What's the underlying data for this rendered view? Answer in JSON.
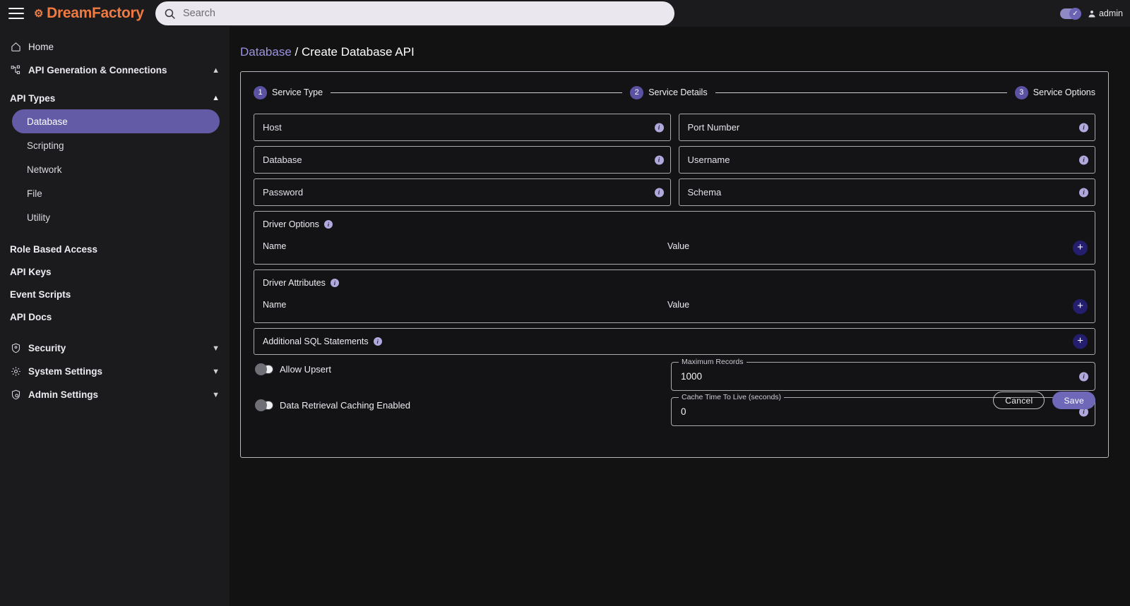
{
  "app": {
    "brand": "DreamFactory",
    "brand_icon": "gear-icon",
    "menu_icon": "hamburger-menu-icon"
  },
  "search": {
    "placeholder": "Search",
    "value": "",
    "icon": "search-icon"
  },
  "topbar": {
    "theme_toggle": {
      "state": "on",
      "icon": "check-icon"
    },
    "user": {
      "name": "admin",
      "icon": "person-icon"
    }
  },
  "sidebar": {
    "items": [
      {
        "label": "Home",
        "icon": "home-icon"
      },
      {
        "label": "API Generation & Connections",
        "icon": "sitemap-icon",
        "chevron": "chevron-up-icon",
        "expanded": true
      }
    ],
    "api_types": {
      "label": "API Types",
      "chevron": "chevron-up-icon",
      "children": [
        {
          "label": "Database",
          "active": true
        },
        {
          "label": "Scripting",
          "active": false
        },
        {
          "label": "Network",
          "active": false
        },
        {
          "label": "File",
          "active": false
        },
        {
          "label": "Utility",
          "active": false
        }
      ]
    },
    "secondary": [
      {
        "label": "Role Based Access"
      },
      {
        "label": "API Keys"
      },
      {
        "label": "Event Scripts"
      },
      {
        "label": "API Docs"
      }
    ],
    "groups": [
      {
        "label": "Security",
        "icon": "shield-icon",
        "chevron": "chevron-down-icon"
      },
      {
        "label": "System Settings",
        "icon": "gear-icon",
        "chevron": "chevron-down-icon"
      },
      {
        "label": "Admin Settings",
        "icon": "shield-lock-icon",
        "chevron": "chevron-down-icon"
      }
    ]
  },
  "breadcrumb": {
    "parent": "Database",
    "separator": "/",
    "current": "Create Database API"
  },
  "stepper": {
    "steps": [
      {
        "num": "1",
        "label": "Service Type"
      },
      {
        "num": "2",
        "label": "Service Details"
      },
      {
        "num": "3",
        "label": "Service Options"
      }
    ]
  },
  "form": {
    "fields": [
      {
        "placeholder": "Host",
        "value": "",
        "info": "i"
      },
      {
        "placeholder": "Port Number",
        "value": "",
        "info": "i"
      },
      {
        "placeholder": "Database",
        "value": "",
        "info": "i"
      },
      {
        "placeholder": "Username",
        "value": "",
        "info": "i"
      },
      {
        "placeholder": "Password",
        "value": "",
        "info": "i"
      },
      {
        "placeholder": "Schema",
        "value": "",
        "info": "i"
      }
    ],
    "driver_options": {
      "title": "Driver Options",
      "info": "i",
      "col_name": "Name",
      "col_value": "Value",
      "add_label": "+"
    },
    "driver_attributes": {
      "title": "Driver Attributes",
      "info": "i",
      "col_name": "Name",
      "col_value": "Value",
      "add_label": "+"
    },
    "additional_sql": {
      "title": "Additional SQL Statements",
      "info": "i",
      "add_label": "+"
    },
    "toggles": [
      {
        "label": "Allow Upsert",
        "state": "off"
      },
      {
        "label": "Data Retrieval Caching Enabled",
        "state": "off"
      }
    ],
    "numeric": [
      {
        "label": "Maximum Records",
        "value": "1000",
        "info": "i"
      },
      {
        "label": "Cache Time To Live (seconds)",
        "value": "0",
        "info": "i"
      }
    ],
    "buttons": {
      "cancel": "Cancel",
      "save": "Save"
    }
  },
  "colors": {
    "brand": "#f07a3f",
    "accent": "#635ba6",
    "accent_light": "#9c93e0",
    "info_badge": "#b0a9de",
    "plus_button": "#241e6e",
    "background": "#121212",
    "panel": "#1b1b1e"
  }
}
